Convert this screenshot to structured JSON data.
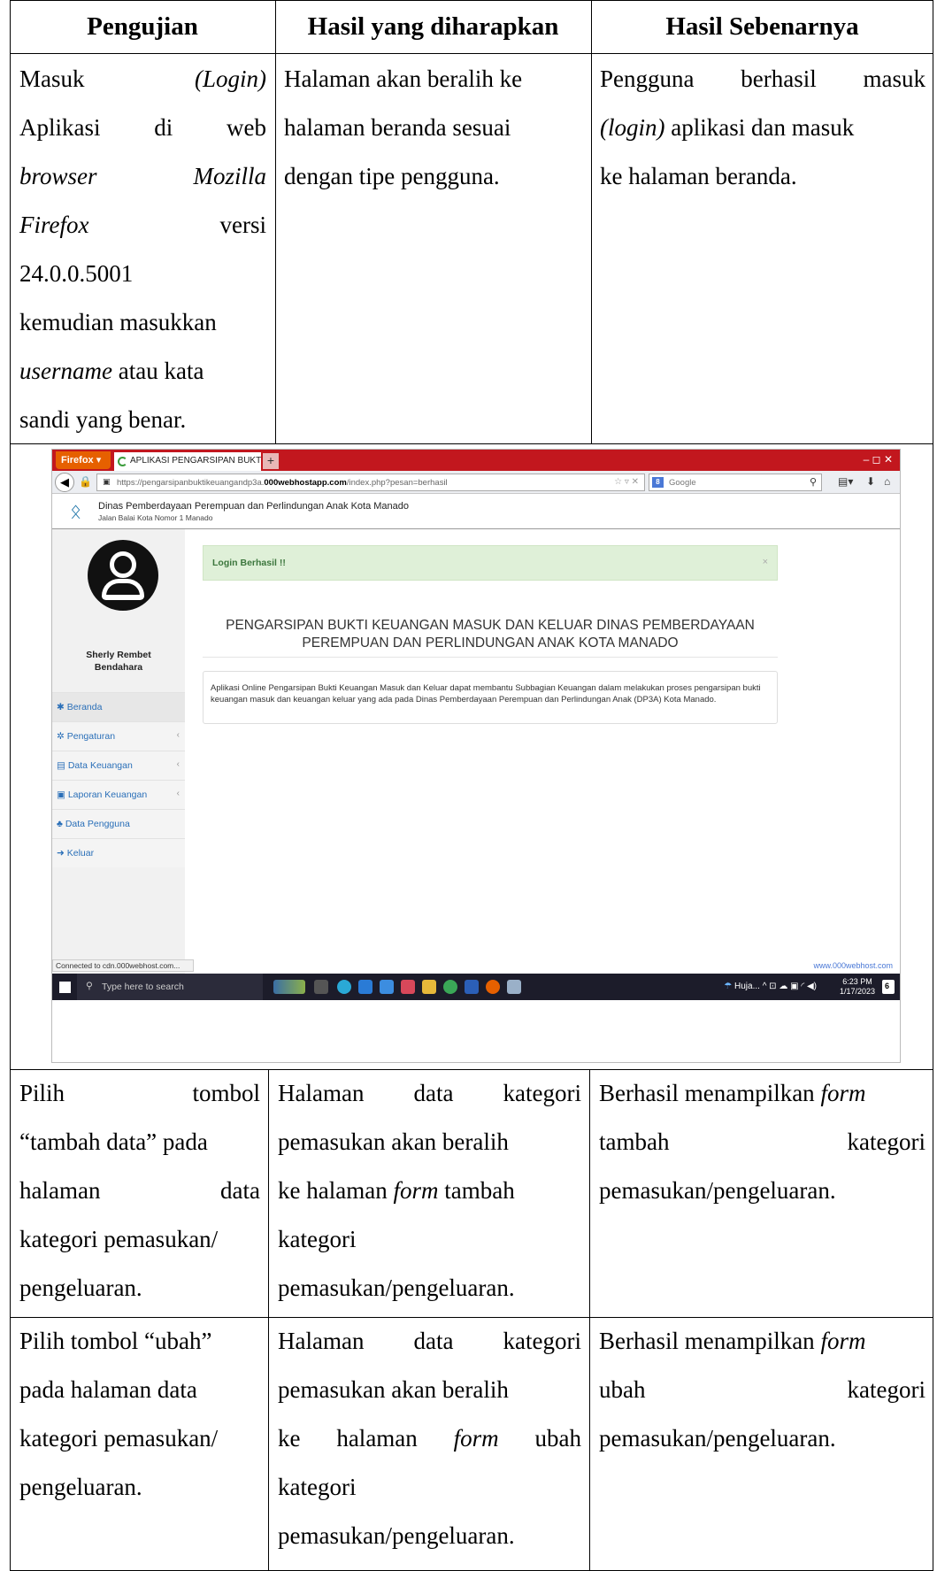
{
  "table": {
    "headers": [
      "Pengujian",
      "Hasil yang diharapkan",
      "Hasil Sebenarnya"
    ],
    "rows": [
      {
        "pengujian": [
          "Masuk",
          "(Login)",
          "Aplikasi",
          "di",
          "web",
          "browser",
          "Mozilla",
          "Firefox",
          "versi",
          "24.0.0.5001",
          "kemudian masukkan",
          "username",
          "atau kata",
          "sandi yang benar."
        ],
        "diharapkan": [
          "Halaman akan beralih ke",
          "halaman beranda sesuai",
          "dengan tipe pengguna."
        ],
        "sebenarnya": [
          "Pengguna",
          "berhasil",
          "masuk",
          "(login)",
          "aplikasi dan masuk",
          "ke halaman beranda."
        ]
      },
      {
        "pengujian": [
          "Pilih",
          "tombol",
          "“tambah data” pada",
          "halaman",
          "data",
          "kategori pemasukan/",
          "pengeluaran."
        ],
        "diharapkan": [
          "Halaman",
          "data",
          "kategori",
          "pemasukan akan beralih",
          "ke halaman",
          "form",
          "tambah",
          "kategori",
          "pemasukan/pengeluaran."
        ],
        "sebenarnya": [
          "Berhasil menampilkan",
          "form",
          "tambah",
          "kategori",
          "pemasukan/pengeluaran."
        ]
      },
      {
        "pengujian": [
          "Pilih tombol “ubah”",
          "pada halaman data",
          "kategori pemasukan/",
          "pengeluaran."
        ],
        "diharapkan": [
          "Halaman",
          "data",
          "kategori",
          "pemasukan akan beralih",
          "ke",
          "halaman",
          "form",
          "ubah",
          "kategori",
          "pemasukan/pengeluaran."
        ],
        "sebenarnya": [
          "Berhasil menampilkan",
          "form",
          "ubah",
          "kategori",
          "pemasukan/pengeluaran."
        ]
      }
    ]
  },
  "screenshot": {
    "browser": {
      "menu_button": "Firefox ▾",
      "tab_title": "APLIKASI PENGARSIPAN BUKTI KEUANG...",
      "new_tab": "+",
      "url_prefix": "https://pengarsipanbuktikeuangandp3a.",
      "url_domain": "000webhostapp.com",
      "url_path": "/index.php?pesan=berhasil",
      "search_engine_letter": "8",
      "search_placeholder": "Google",
      "window_controls": "–   ◻   ✕"
    },
    "site": {
      "org_name": "Dinas Pemberdayaan Perempuan dan Perlindungan Anak Kota Manado",
      "address": "Jalan Balai Kota Nomor 1 Manado"
    },
    "user": {
      "name": "Sherly Rembet",
      "role": "Bendahara"
    },
    "menu": [
      {
        "icon": "home-icon",
        "label": "Beranda",
        "glyph": "✱",
        "chevron": ""
      },
      {
        "icon": "gear-icon",
        "label": "Pengaturan",
        "glyph": "✲",
        "chevron": "‹"
      },
      {
        "icon": "file-icon",
        "label": "Data Keuangan",
        "glyph": "▤",
        "chevron": "‹"
      },
      {
        "icon": "report-icon",
        "label": "Laporan Keuangan",
        "glyph": "▣",
        "chevron": "‹"
      },
      {
        "icon": "users-icon",
        "label": "Data Pengguna",
        "glyph": "♣",
        "chevron": ""
      },
      {
        "icon": "logout-icon",
        "label": "Keluar",
        "glyph": "➜",
        "chevron": ""
      }
    ],
    "alert": {
      "text": "Login Berhasil !!",
      "close": "×"
    },
    "heading_line1": "PENGARSIPAN BUKTI KEUANGAN MASUK DAN KELUAR DINAS PEMBERDAYAAN",
    "heading_line2": "PEREMPUAN DAN PERLINDUNGAN ANAK KOTA MANADO",
    "description": "Aplikasi Online Pengarsipan Bukti Keuangan Masuk dan Keluar dapat membantu Subbagian Keuangan dalam melakukan proses pengarsipan bukti keuangan masuk dan keuangan keluar yang ada pada Dinas Pemberdayaan Perempuan dan Perlindungan Anak (DP3A) Kota Manado.",
    "status": "Connected to cdn.000webhost.com...",
    "watermark": "www.000webhost.com",
    "taskbar": {
      "search_placeholder": "Type here to search",
      "weather": "Huja...",
      "tray_icons": "^ ⊡ ☁ ▣ ◜ ◀)",
      "time": "6:23 PM",
      "date": "1/17/2023",
      "notification_count": "6"
    },
    "colors": {
      "titlebar": "#c2171e",
      "alert_bg": "#dff0d8",
      "alert_text": "#3c763d",
      "menu_link": "#2a6fb8",
      "taskbar": "#1c1c2a"
    }
  }
}
